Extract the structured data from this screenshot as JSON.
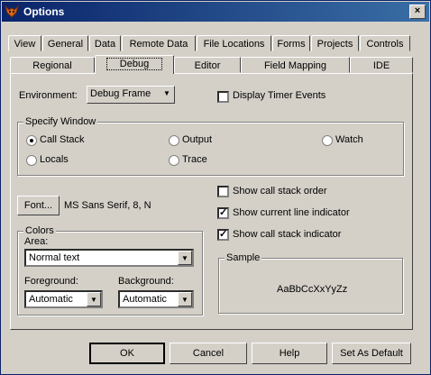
{
  "window": {
    "title": "Options",
    "close_glyph": "×",
    "icon": "fox-icon"
  },
  "tabs_row1": [
    "View",
    "General",
    "Data",
    "Remote Data",
    "File Locations",
    "Forms",
    "Projects",
    "Controls"
  ],
  "tabs_row2": [
    "Regional",
    "Debug",
    "Editor",
    "Field Mapping",
    "IDE"
  ],
  "active_tab": "Debug",
  "environment": {
    "label": "Environment:",
    "value": "Debug Frame"
  },
  "display_timer_events": {
    "label": "Display Timer Events",
    "checked": false
  },
  "specify_window": {
    "legend": "Specify Window",
    "options": [
      "Call Stack",
      "Output",
      "Watch",
      "Locals",
      "Trace"
    ],
    "selected": "Call Stack"
  },
  "font": {
    "button": "Font...",
    "value": "MS Sans Serif, 8, N"
  },
  "colors": {
    "legend": "Colors",
    "area_label": "Area:",
    "area_value": "Normal text",
    "foreground_label": "Foreground:",
    "foreground_value": "Automatic",
    "background_label": "Background:",
    "background_value": "Automatic"
  },
  "checks": [
    {
      "label": "Show call stack order",
      "checked": false
    },
    {
      "label": "Show current line indicator",
      "checked": true
    },
    {
      "label": "Show call stack indicator",
      "checked": true
    }
  ],
  "sample": {
    "legend": "Sample",
    "text": "AaBbCcXxYyZz"
  },
  "buttons": {
    "ok": "OK",
    "cancel": "Cancel",
    "help": "Help",
    "default": "Set As Default"
  },
  "check_glyph": "✓",
  "arrow_glyph": "▼"
}
